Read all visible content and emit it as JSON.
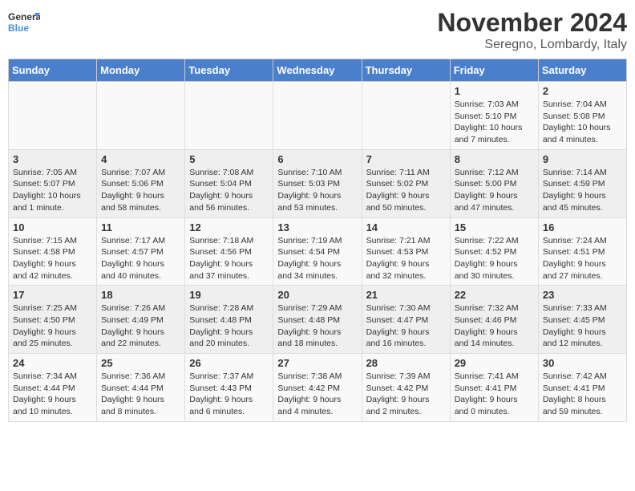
{
  "logo": {
    "text_general": "General",
    "text_blue": "Blue"
  },
  "header": {
    "month": "November 2024",
    "location": "Seregno, Lombardy, Italy"
  },
  "weekdays": [
    "Sunday",
    "Monday",
    "Tuesday",
    "Wednesday",
    "Thursday",
    "Friday",
    "Saturday"
  ],
  "weeks": [
    [
      {
        "day": "",
        "info": ""
      },
      {
        "day": "",
        "info": ""
      },
      {
        "day": "",
        "info": ""
      },
      {
        "day": "",
        "info": ""
      },
      {
        "day": "",
        "info": ""
      },
      {
        "day": "1",
        "info": "Sunrise: 7:03 AM\nSunset: 5:10 PM\nDaylight: 10 hours and 7 minutes."
      },
      {
        "day": "2",
        "info": "Sunrise: 7:04 AM\nSunset: 5:08 PM\nDaylight: 10 hours and 4 minutes."
      }
    ],
    [
      {
        "day": "3",
        "info": "Sunrise: 7:05 AM\nSunset: 5:07 PM\nDaylight: 10 hours and 1 minute."
      },
      {
        "day": "4",
        "info": "Sunrise: 7:07 AM\nSunset: 5:06 PM\nDaylight: 9 hours and 58 minutes."
      },
      {
        "day": "5",
        "info": "Sunrise: 7:08 AM\nSunset: 5:04 PM\nDaylight: 9 hours and 56 minutes."
      },
      {
        "day": "6",
        "info": "Sunrise: 7:10 AM\nSunset: 5:03 PM\nDaylight: 9 hours and 53 minutes."
      },
      {
        "day": "7",
        "info": "Sunrise: 7:11 AM\nSunset: 5:02 PM\nDaylight: 9 hours and 50 minutes."
      },
      {
        "day": "8",
        "info": "Sunrise: 7:12 AM\nSunset: 5:00 PM\nDaylight: 9 hours and 47 minutes."
      },
      {
        "day": "9",
        "info": "Sunrise: 7:14 AM\nSunset: 4:59 PM\nDaylight: 9 hours and 45 minutes."
      }
    ],
    [
      {
        "day": "10",
        "info": "Sunrise: 7:15 AM\nSunset: 4:58 PM\nDaylight: 9 hours and 42 minutes."
      },
      {
        "day": "11",
        "info": "Sunrise: 7:17 AM\nSunset: 4:57 PM\nDaylight: 9 hours and 40 minutes."
      },
      {
        "day": "12",
        "info": "Sunrise: 7:18 AM\nSunset: 4:56 PM\nDaylight: 9 hours and 37 minutes."
      },
      {
        "day": "13",
        "info": "Sunrise: 7:19 AM\nSunset: 4:54 PM\nDaylight: 9 hours and 34 minutes."
      },
      {
        "day": "14",
        "info": "Sunrise: 7:21 AM\nSunset: 4:53 PM\nDaylight: 9 hours and 32 minutes."
      },
      {
        "day": "15",
        "info": "Sunrise: 7:22 AM\nSunset: 4:52 PM\nDaylight: 9 hours and 30 minutes."
      },
      {
        "day": "16",
        "info": "Sunrise: 7:24 AM\nSunset: 4:51 PM\nDaylight: 9 hours and 27 minutes."
      }
    ],
    [
      {
        "day": "17",
        "info": "Sunrise: 7:25 AM\nSunset: 4:50 PM\nDaylight: 9 hours and 25 minutes."
      },
      {
        "day": "18",
        "info": "Sunrise: 7:26 AM\nSunset: 4:49 PM\nDaylight: 9 hours and 22 minutes."
      },
      {
        "day": "19",
        "info": "Sunrise: 7:28 AM\nSunset: 4:48 PM\nDaylight: 9 hours and 20 minutes."
      },
      {
        "day": "20",
        "info": "Sunrise: 7:29 AM\nSunset: 4:48 PM\nDaylight: 9 hours and 18 minutes."
      },
      {
        "day": "21",
        "info": "Sunrise: 7:30 AM\nSunset: 4:47 PM\nDaylight: 9 hours and 16 minutes."
      },
      {
        "day": "22",
        "info": "Sunrise: 7:32 AM\nSunset: 4:46 PM\nDaylight: 9 hours and 14 minutes."
      },
      {
        "day": "23",
        "info": "Sunrise: 7:33 AM\nSunset: 4:45 PM\nDaylight: 9 hours and 12 minutes."
      }
    ],
    [
      {
        "day": "24",
        "info": "Sunrise: 7:34 AM\nSunset: 4:44 PM\nDaylight: 9 hours and 10 minutes."
      },
      {
        "day": "25",
        "info": "Sunrise: 7:36 AM\nSunset: 4:44 PM\nDaylight: 9 hours and 8 minutes."
      },
      {
        "day": "26",
        "info": "Sunrise: 7:37 AM\nSunset: 4:43 PM\nDaylight: 9 hours and 6 minutes."
      },
      {
        "day": "27",
        "info": "Sunrise: 7:38 AM\nSunset: 4:42 PM\nDaylight: 9 hours and 4 minutes."
      },
      {
        "day": "28",
        "info": "Sunrise: 7:39 AM\nSunset: 4:42 PM\nDaylight: 9 hours and 2 minutes."
      },
      {
        "day": "29",
        "info": "Sunrise: 7:41 AM\nSunset: 4:41 PM\nDaylight: 9 hours and 0 minutes."
      },
      {
        "day": "30",
        "info": "Sunrise: 7:42 AM\nSunset: 4:41 PM\nDaylight: 8 hours and 59 minutes."
      }
    ]
  ]
}
